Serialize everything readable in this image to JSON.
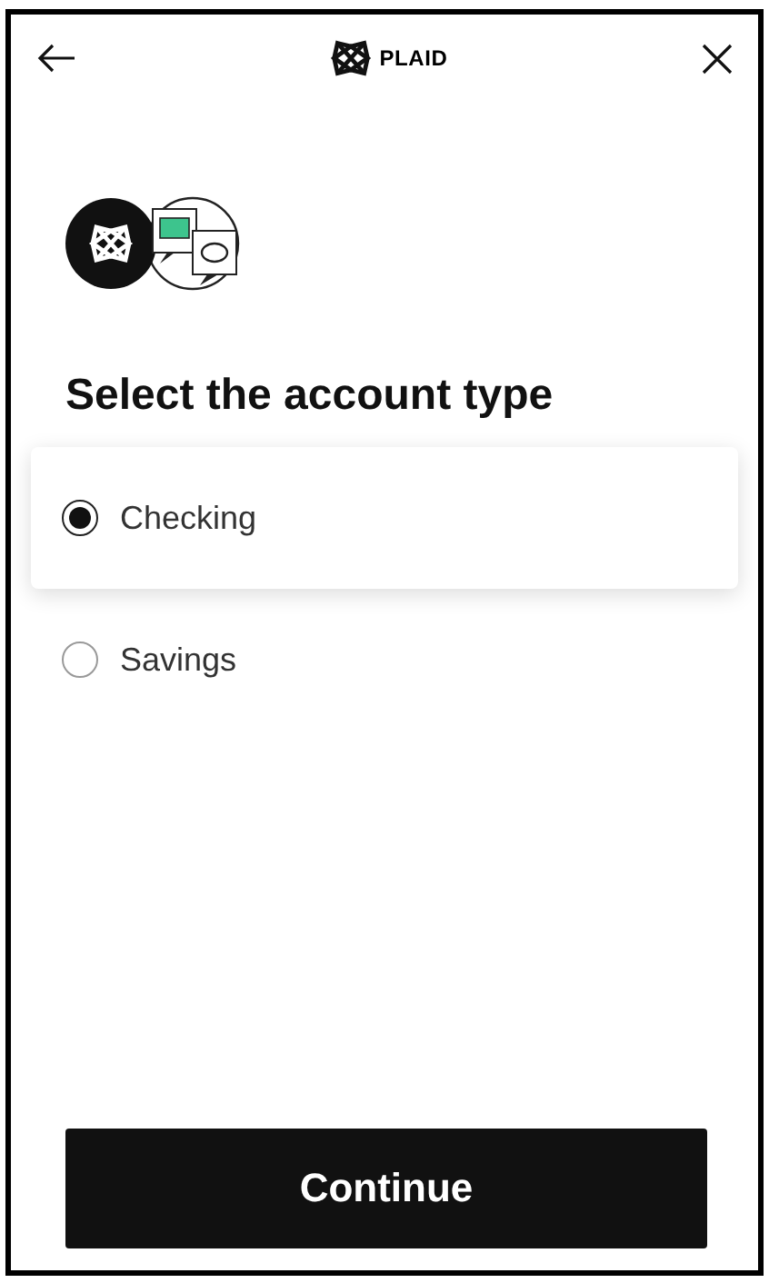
{
  "header": {
    "brand": "PLAID"
  },
  "title": "Select the account type",
  "options": [
    {
      "label": "Checking",
      "selected": true
    },
    {
      "label": "Savings",
      "selected": false
    }
  ],
  "button": "Continue"
}
